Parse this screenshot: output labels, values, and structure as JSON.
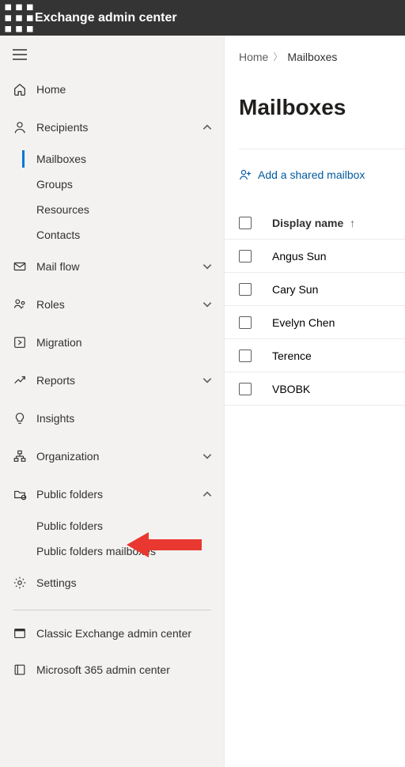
{
  "brand": "Exchange admin center",
  "breadcrumb": {
    "home": "Home",
    "current": "Mailboxes"
  },
  "page": {
    "title": "Mailboxes"
  },
  "toolbar": {
    "add_shared": "Add a shared mailbox"
  },
  "table": {
    "header_displayname": "Display name",
    "rows": [
      {
        "displayname": "Angus Sun"
      },
      {
        "displayname": "Cary Sun"
      },
      {
        "displayname": "Evelyn Chen"
      },
      {
        "displayname": "Terence"
      },
      {
        "displayname": "VBOBK"
      }
    ]
  },
  "nav": {
    "home": "Home",
    "recipients": "Recipients",
    "recipients_sub": {
      "mailboxes": "Mailboxes",
      "groups": "Groups",
      "resources": "Resources",
      "contacts": "Contacts"
    },
    "mailflow": "Mail flow",
    "roles": "Roles",
    "migration": "Migration",
    "reports": "Reports",
    "insights": "Insights",
    "organization": "Organization",
    "public_folders": "Public folders",
    "public_folders_sub": {
      "public_folders": "Public folders",
      "public_folders_mailboxes": "Public folders mailboxes"
    },
    "settings": "Settings",
    "classic": "Classic Exchange admin center",
    "m365": "Microsoft 365 admin center"
  }
}
